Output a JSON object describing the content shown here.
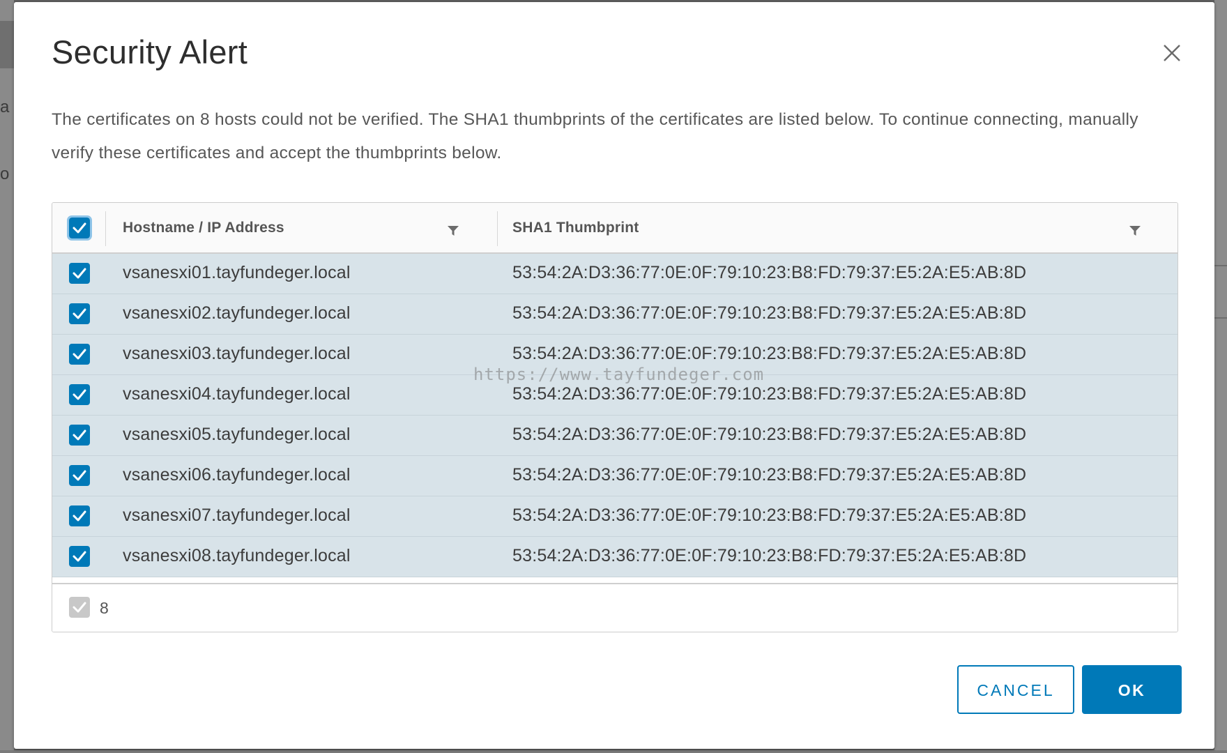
{
  "dialog": {
    "title": "Security Alert",
    "description": "The certificates on 8 hosts could not be verified. The SHA1 thumbprints of the certificates are listed below. To continue connecting, manually verify these certificates and accept the thumbprints below.",
    "cancel_label": "CANCEL",
    "ok_label": "OK"
  },
  "table": {
    "columns": [
      "Hostname / IP Address",
      "SHA1 Thumbprint"
    ],
    "header_checked": true,
    "rows": [
      {
        "host": "vsanesxi01.tayfundeger.local",
        "thumbprint": "53:54:2A:D3:36:77:0E:0F:79:10:23:B8:FD:79:37:E5:2A:E5:AB:8D",
        "checked": true
      },
      {
        "host": "vsanesxi02.tayfundeger.local",
        "thumbprint": "53:54:2A:D3:36:77:0E:0F:79:10:23:B8:FD:79:37:E5:2A:E5:AB:8D",
        "checked": true
      },
      {
        "host": "vsanesxi03.tayfundeger.local",
        "thumbprint": "53:54:2A:D3:36:77:0E:0F:79:10:23:B8:FD:79:37:E5:2A:E5:AB:8D",
        "checked": true
      },
      {
        "host": "vsanesxi04.tayfundeger.local",
        "thumbprint": "53:54:2A:D3:36:77:0E:0F:79:10:23:B8:FD:79:37:E5:2A:E5:AB:8D",
        "checked": true
      },
      {
        "host": "vsanesxi05.tayfundeger.local",
        "thumbprint": "53:54:2A:D3:36:77:0E:0F:79:10:23:B8:FD:79:37:E5:2A:E5:AB:8D",
        "checked": true
      },
      {
        "host": "vsanesxi06.tayfundeger.local",
        "thumbprint": "53:54:2A:D3:36:77:0E:0F:79:10:23:B8:FD:79:37:E5:2A:E5:AB:8D",
        "checked": true
      },
      {
        "host": "vsanesxi07.tayfundeger.local",
        "thumbprint": "53:54:2A:D3:36:77:0E:0F:79:10:23:B8:FD:79:37:E5:2A:E5:AB:8D",
        "checked": true
      },
      {
        "host": "vsanesxi08.tayfundeger.local",
        "thumbprint": "53:54:2A:D3:36:77:0E:0F:79:10:23:B8:FD:79:37:E5:2A:E5:AB:8D",
        "checked": true
      }
    ],
    "footer_count": "8"
  },
  "watermark": "https://www.tayfundeger.com",
  "background": {
    "fragment_1": "a",
    "fragment_2": "o"
  },
  "colors": {
    "accent": "#0079b8",
    "row_selected": "#d8e3e9",
    "overlay": "#5f5f5f"
  },
  "icons": {
    "close": "close-icon",
    "filter": "filter-icon",
    "check": "checkmark-icon"
  }
}
